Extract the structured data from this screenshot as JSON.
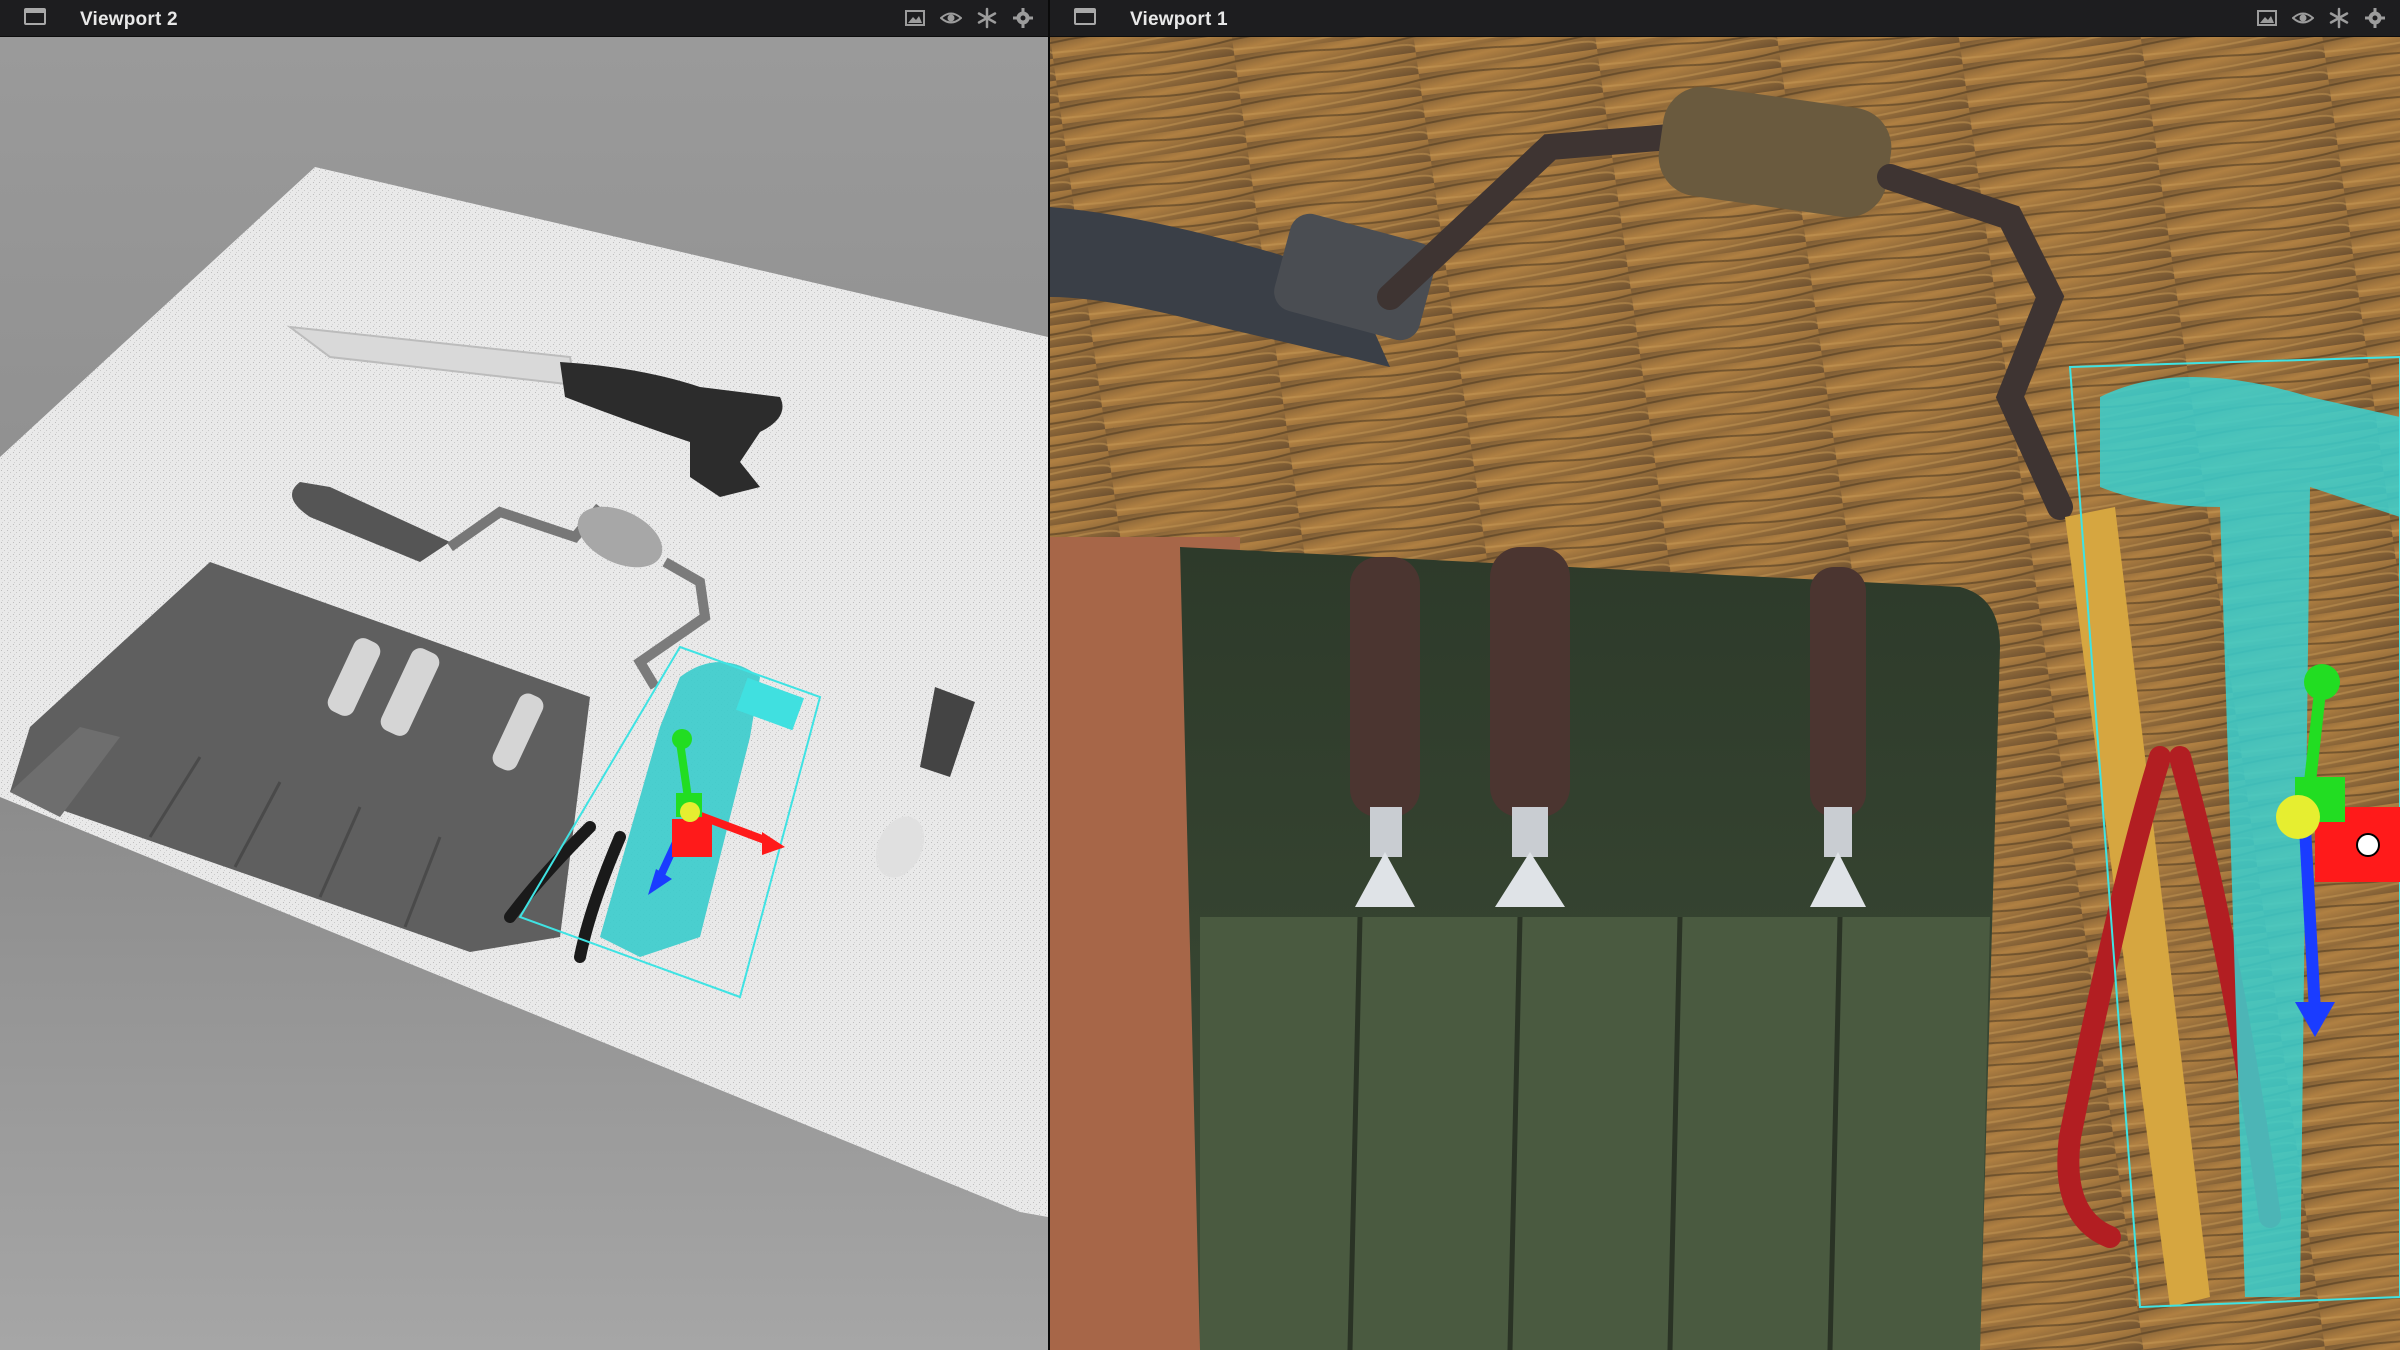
{
  "viewports": [
    {
      "id": "vp2",
      "title": "Viewport 2"
    },
    {
      "id": "vp1",
      "title": "Viewport 1"
    }
  ],
  "toolbar_icons": [
    "image-icon",
    "eye-icon",
    "asterisk-icon",
    "gear-icon"
  ],
  "colors": {
    "header_bg": "#1d1d1f",
    "selection_cyan": "#35d6d6",
    "gizmo_x": "#ff1a1a",
    "gizmo_y": "#22dd22",
    "gizmo_z": "#1a3cff",
    "gizmo_center": "#e6ee30"
  }
}
